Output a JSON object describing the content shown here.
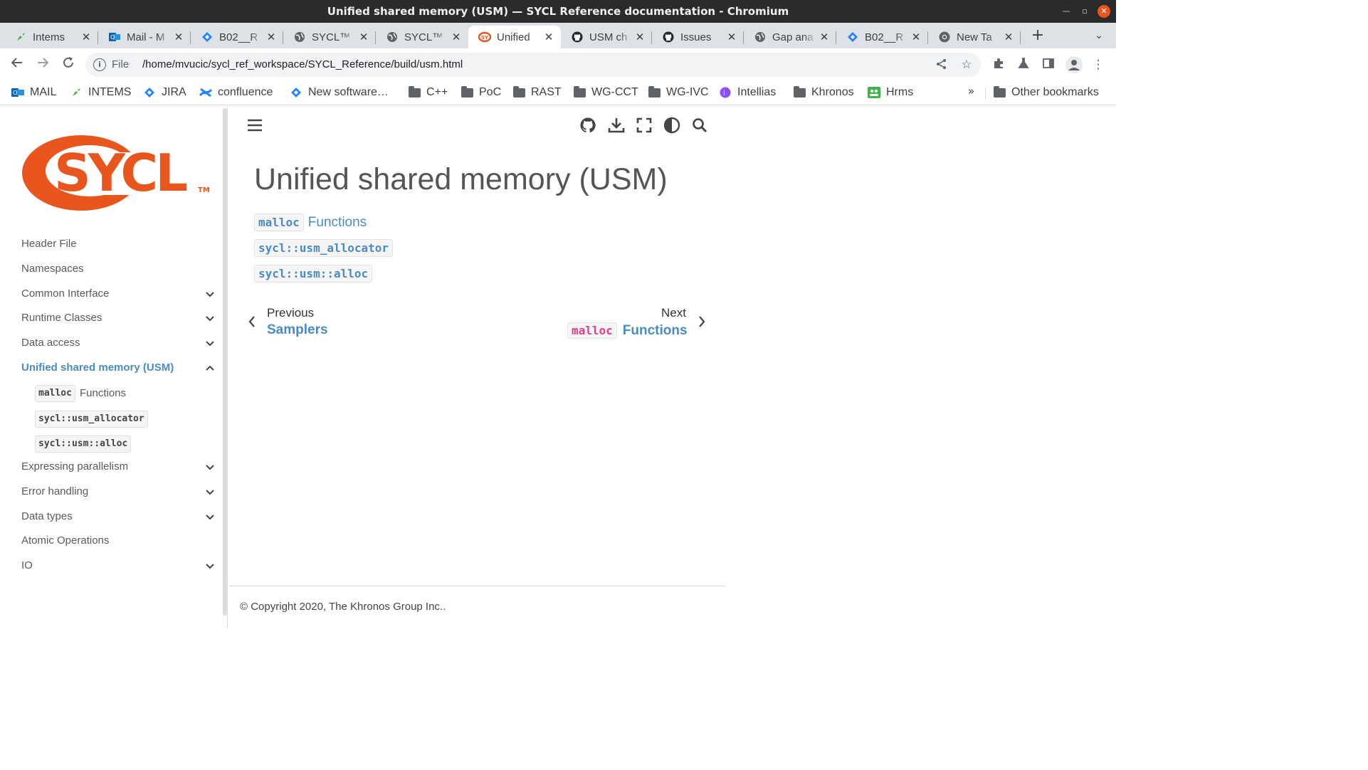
{
  "window": {
    "title": "Unified shared memory (USM) — SYCL Reference documentation - Chromium"
  },
  "tabs": [
    {
      "label": "Intems",
      "icon": "rocket-icon",
      "active": false
    },
    {
      "label": "Mail - M",
      "icon": "outlook-icon",
      "active": false
    },
    {
      "label": "B02__R",
      "icon": "jira-icon",
      "active": false
    },
    {
      "label": "SYCL™",
      "icon": "globe-icon",
      "active": false
    },
    {
      "label": "SYCL™",
      "icon": "globe-icon",
      "active": false
    },
    {
      "label": "Unified",
      "icon": "sycl-favicon",
      "active": true
    },
    {
      "label": "USM ch",
      "icon": "github-icon",
      "active": false
    },
    {
      "label": "Issues",
      "icon": "github-icon",
      "active": false
    },
    {
      "label": "Gap ana",
      "icon": "globe-icon",
      "active": false
    },
    {
      "label": "B02__R",
      "icon": "jira-icon",
      "active": false
    },
    {
      "label": "New Ta",
      "icon": "chrome-icon",
      "active": false
    }
  ],
  "omnibox": {
    "scheme": "File",
    "url": "/home/mvucic/sycl_ref_workspace/SYCL_Reference/build/usm.html"
  },
  "bookmarks": [
    {
      "label": "MAIL",
      "icon": "outlook-icon"
    },
    {
      "label": "INTEMS",
      "icon": "rocket-icon"
    },
    {
      "label": "JIRA",
      "icon": "jira-icon"
    },
    {
      "label": "confluence",
      "icon": "confluence-icon"
    },
    {
      "label": "New software…",
      "icon": "jira-icon"
    },
    {
      "label": "C++",
      "icon": "folder-icon"
    },
    {
      "label": "PoC",
      "icon": "folder-icon"
    },
    {
      "label": "RAST",
      "icon": "folder-icon"
    },
    {
      "label": "WG-CCT",
      "icon": "folder-icon"
    },
    {
      "label": "WG-IVC",
      "icon": "folder-icon"
    },
    {
      "label": "Intellias",
      "icon": "intellias-icon"
    },
    {
      "label": "Khronos",
      "icon": "folder-icon"
    },
    {
      "label": "Hrms",
      "icon": "hrms-icon"
    }
  ],
  "bookmarks_overflow": "»",
  "other_bookmarks": "Other bookmarks",
  "logo": {
    "text": "SYCL",
    "tm": "TM",
    "color": "#e8561e"
  },
  "sidebar": {
    "items": [
      {
        "label": "Header File",
        "expandable": false
      },
      {
        "label": "Namespaces",
        "expandable": false
      },
      {
        "label": "Common Interface",
        "expandable": true
      },
      {
        "label": "Runtime Classes",
        "expandable": true
      },
      {
        "label": "Data access",
        "expandable": true
      },
      {
        "label": "Unified shared memory (USM)",
        "expandable": true,
        "active": true
      },
      {
        "label": "Expressing parallelism",
        "expandable": true
      },
      {
        "label": "Error handling",
        "expandable": true
      },
      {
        "label": "Data types",
        "expandable": true
      },
      {
        "label": "Atomic Operations",
        "expandable": false
      },
      {
        "label": "IO",
        "expandable": true
      }
    ],
    "subitems": [
      {
        "code": "malloc",
        "rest": "Functions"
      },
      {
        "code": "sycl::usm_allocator",
        "rest": ""
      },
      {
        "code": "sycl::usm::alloc",
        "rest": ""
      }
    ]
  },
  "main": {
    "title": "Unified shared memory (USM)",
    "toc": [
      {
        "code": "malloc",
        "rest": "Functions"
      },
      {
        "code": "sycl::usm_allocator",
        "rest": ""
      },
      {
        "code": "sycl::usm::alloc",
        "rest": ""
      }
    ],
    "prev": {
      "label": "Previous",
      "title": "Samplers"
    },
    "next": {
      "label": "Next",
      "code": "malloc",
      "title": "Functions"
    }
  },
  "footer": {
    "copyright": "© Copyright 2020, The Khronos Group Inc.."
  },
  "colors": {
    "link": "#4a8bc2",
    "code_accent": "#e83e8c",
    "titlebar": "#2b2b2b",
    "tabstrip": "#dee1e6"
  }
}
